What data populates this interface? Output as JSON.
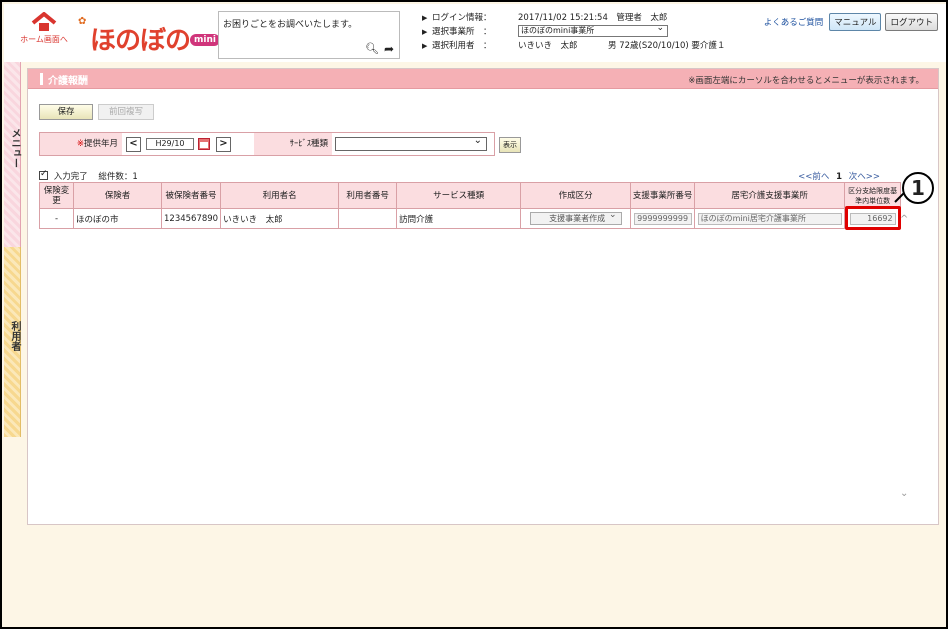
{
  "header": {
    "home_label": "ホーム画面へ",
    "logo_text": "ほのぼの",
    "logo_badge": "mini",
    "search_placeholder": "お困りごとをお調べいたします。",
    "login_label": "ログイン情報：",
    "login_value": "2017/11/02 15:21:54　管理者　太郎",
    "office_label": "選択事業所　：",
    "office_value": "ほのぼのmini事業所",
    "user_label": "選択利用者　：",
    "user_value": "いきいき　太郎",
    "user_detail": "男 72歳(S20/10/10) 要介護１",
    "faq_link": "よくあるご質問",
    "manual_button": "マニュアル",
    "logout_button": "ログアウト"
  },
  "side": {
    "menu_label": "メニュー",
    "user_label": "利用者"
  },
  "panel": {
    "title": "介護報酬",
    "hint": "※画面左端にカーソルを合わせるとメニューが表示されます。",
    "save_button": "保存",
    "copy_button": "前回複写",
    "filter": {
      "month_label": "提供年月",
      "required_mark": "※",
      "month_value": "H29/10",
      "prev": "<",
      "next": ">",
      "service_label": "ｻｰﾋﾞｽ種類",
      "service_value": "",
      "show_button": "表示"
    },
    "input_done": "入力完了",
    "total_label": "総件数：1",
    "pager": {
      "prev": "<<前へ",
      "page": "1",
      "next": "次へ>>"
    },
    "columns": {
      "c1": "保険変更",
      "c2": "保険者",
      "c3": "被保険者番号",
      "c4": "利用者名",
      "c5": "利用者番号",
      "c6": "サービス種類",
      "c7": "作成区分",
      "c8": "支援事業所番号",
      "c9": "居宅介護支援事業所",
      "c10": "区分支給限度基準内単位数"
    },
    "row": {
      "change": "-",
      "insurer": "ほのぼの市",
      "insured_no": "1234567890",
      "name": "いきいき　太郎",
      "user_no": "",
      "service": "訪問介護",
      "category": "支援事業者作成",
      "office_no": "9999999999",
      "office_name": "ほのぼのmini居宅介護事業所",
      "units": "16692"
    }
  },
  "callout": "1"
}
